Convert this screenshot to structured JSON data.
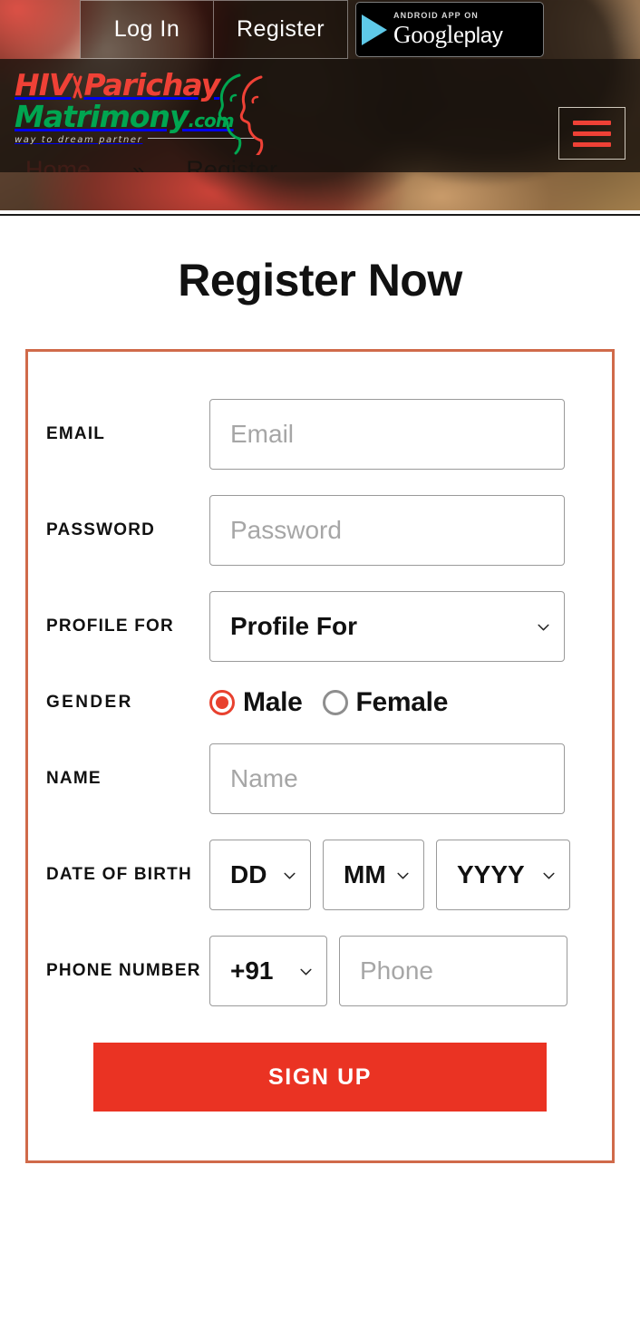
{
  "topbar": {
    "login_label": "Log In",
    "register_label": "Register",
    "gplay": {
      "eyebrow": "ANDROID APP ON",
      "brand": "Google",
      "store": "play"
    }
  },
  "brand": {
    "line1_a": "HIV",
    "line1_b": "Parichay",
    "line2": "Matrimony",
    "line2_tld": ".com",
    "tagline": "way to dream partner"
  },
  "breadcrumb": {
    "home": "Home",
    "separator": "»",
    "current": "Register"
  },
  "main": {
    "page_title": "Register Now"
  },
  "form": {
    "labels": {
      "email": "EMAIL",
      "password": "PASSWORD",
      "profile_for": "PROFILE FOR",
      "gender": "GENDER",
      "name": "NAME",
      "dob": "DATE OF BIRTH",
      "phone": "PHONE NUMBER"
    },
    "email": {
      "value": "",
      "placeholder": "Email"
    },
    "password": {
      "value": "",
      "placeholder": "Password"
    },
    "profile_for": {
      "selected": "Profile For"
    },
    "gender": {
      "male_label": "Male",
      "female_label": "Female",
      "selected": "Male"
    },
    "name": {
      "value": "",
      "placeholder": "Name"
    },
    "dob": {
      "day_selected": "DD",
      "month_selected": "MM",
      "year_selected": "YYYY"
    },
    "phone": {
      "country_code_selected": "+91",
      "value": "",
      "placeholder": "Phone"
    },
    "submit_label": "SIGN UP"
  },
  "colors": {
    "accent_red": "#ea3323",
    "brand_red": "#ef4136",
    "brand_green": "#00a651",
    "card_border": "#d06a4a",
    "link_red": "#e0483c"
  }
}
